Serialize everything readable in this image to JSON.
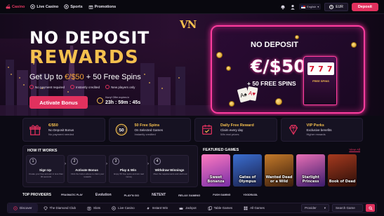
{
  "topnav": {
    "items": [
      {
        "label": "Casino",
        "icon": "cherry-icon",
        "active": true
      },
      {
        "label": "Live Casino",
        "icon": "chip-icon",
        "active": false
      },
      {
        "label": "Sports",
        "icon": "football-icon",
        "active": false
      },
      {
        "label": "Promotions",
        "icon": "gift-icon",
        "active": false
      }
    ],
    "language": "English",
    "currency": "EUR",
    "deposit_label": "Deposit"
  },
  "hero": {
    "logo": "VN",
    "title_line1": "NO DEPOSIT",
    "title_line2": "REWARDS",
    "subtitle_prefix": "Get Up to ",
    "subtitle_highlight": "€/$50",
    "subtitle_suffix": " + 50 Free Spins",
    "checks": [
      "No payment required",
      "Instantly credited",
      "New players only"
    ],
    "cta_label": "Activate Bonus",
    "timer_label": "Hurry! Offer expires in",
    "timer_value": "23h : 59m : 45s",
    "neon_line1": "NO DEPOSIT",
    "neon_line2": "€/$50",
    "neon_line3": "+ 50 FREE SPINS",
    "slot_reels": [
      "7",
      "7",
      "7"
    ],
    "slot_label": "FREE SPINS",
    "card_suits": [
      "A♠",
      "A♥"
    ]
  },
  "perks": [
    {
      "icon": "gift-icon",
      "title": "€/$50",
      "line1": "No Deposit Bonus",
      "line2": "No payment needed"
    },
    {
      "icon": "fifty-badge-icon",
      "badge": "50",
      "title": "50 Free Spins",
      "line1": "On Selected Games",
      "line2": "Instantly credited"
    },
    {
      "icon": "calendar-icon",
      "title": "Daily Free Reward",
      "line1": "Claim every day",
      "line2": "Win real prizes"
    },
    {
      "icon": "diamond-icon",
      "title": "VIP Perks",
      "line1": "Exclusive benefits",
      "line2": "Higher rewards"
    }
  ],
  "how": {
    "title": "HOW IT WORKS",
    "steps": [
      {
        "num": "1",
        "title": "Sign Up",
        "desc": "Create your free account in less than 30 seconds"
      },
      {
        "num": "2",
        "title": "Activate Bonus",
        "desc": "Click the button above to claim your rewards"
      },
      {
        "num": "3",
        "title": "Play & Win",
        "desc": "Enjoy 50 free spins and win real money"
      },
      {
        "num": "4",
        "title": "Withdraw Winnings",
        "desc": "Meet the requirements and cash out"
      }
    ]
  },
  "featured": {
    "title": "FEATURED GAMES",
    "view_all": "View All",
    "games": [
      {
        "name": "Sweet Bonanza",
        "color1": "#ff7ac0",
        "color2": "#7a2fa8"
      },
      {
        "name": "Gates of Olympus",
        "color1": "#3b6fd1",
        "color2": "#1a1f4a"
      },
      {
        "name": "Wanted Dead or a Wild",
        "color1": "#c47a2a",
        "color2": "#3a1d0d"
      },
      {
        "name": "Starlight Princess",
        "color1": "#e86fb5",
        "color2": "#3a1b6b"
      },
      {
        "name": "Book of Dead",
        "color1": "#a63a1f",
        "color2": "#2a0e08"
      }
    ]
  },
  "providers": {
    "title": "TOP PROVIDERS",
    "items": [
      "PRAGMATIC PLAY",
      "Evolution",
      "PLAY'N GO",
      "NETENT",
      "RELAX GAMING",
      "PUSH GAMING",
      "YGGDRASIL"
    ]
  },
  "bottomnav": {
    "items": [
      {
        "label": "Discover",
        "icon": "compass-icon",
        "active": true
      },
      {
        "label": "The Diamond Club",
        "icon": "diamond-icon",
        "active": false
      },
      {
        "label": "Slots",
        "icon": "slot-icon",
        "active": false
      },
      {
        "label": "Live Casino",
        "icon": "chip-icon",
        "active": false
      },
      {
        "label": "Instant Win",
        "icon": "bolt-icon",
        "active": false
      },
      {
        "label": "Jackpot",
        "icon": "crown-icon",
        "active": false
      },
      {
        "label": "Table Games",
        "icon": "cards-icon",
        "active": false
      },
      {
        "label": "All Games",
        "icon": "grid-icon",
        "active": false
      }
    ],
    "provider_label": "Provider",
    "search_placeholder": "Search Game"
  },
  "colors": {
    "accent": "#e1315e",
    "gold": "#f5c04e",
    "neon": "#ff3d9e",
    "bg": "#0c0a14"
  }
}
